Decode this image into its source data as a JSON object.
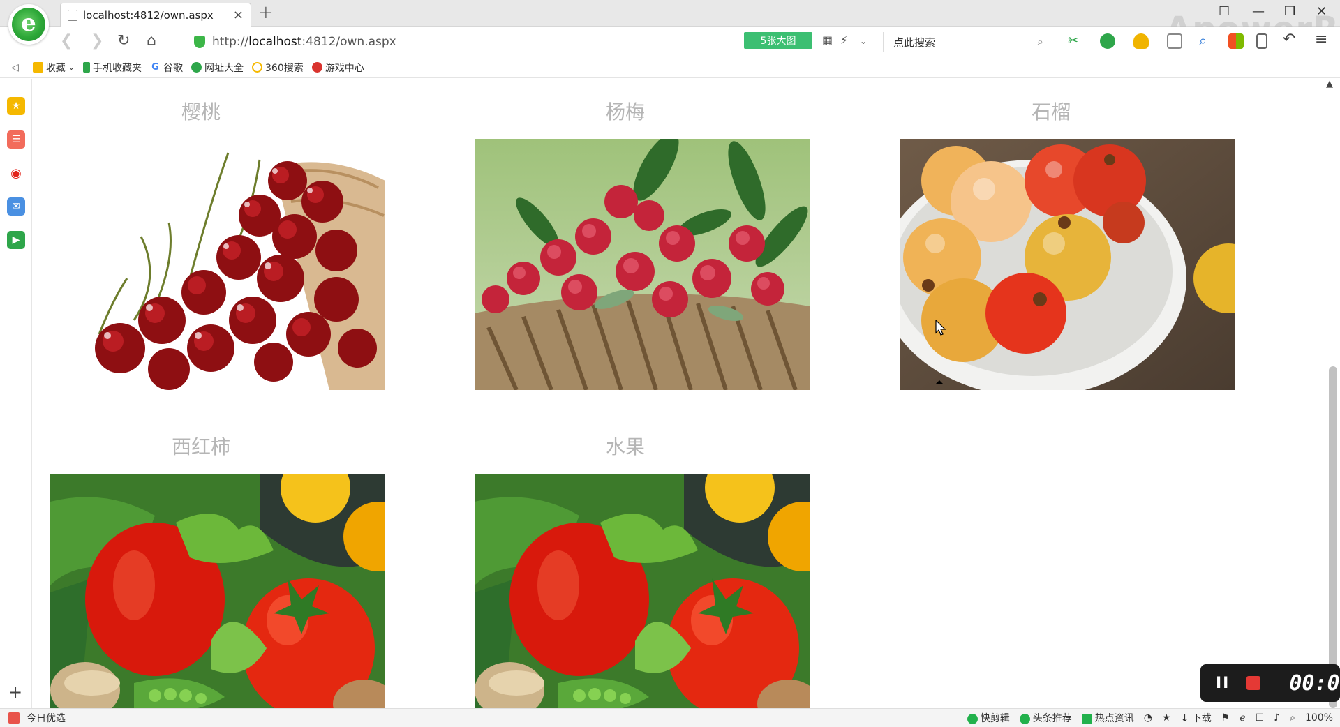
{
  "browser": {
    "tab_title": "localhost:4812/own.aspx",
    "tab_close": "×",
    "new_tab": "+",
    "url_prefix": "http://",
    "url_host": "localhost",
    "url_rest": ":4812/own.aspx",
    "big_image_button": "5张大图",
    "search_placeholder": "点此搜索",
    "watermark": "ApowerREC"
  },
  "bookmarks": [
    {
      "label": "收藏",
      "icon": "star-icon"
    },
    {
      "label": "手机收藏夹",
      "icon": "phone-icon"
    },
    {
      "label": "谷歌",
      "icon": "google-icon"
    },
    {
      "label": "网址大全",
      "icon": "globe-icon"
    },
    {
      "label": "360搜索",
      "icon": "search360-icon"
    },
    {
      "label": "游戏中心",
      "icon": "game-icon"
    }
  ],
  "fruits": [
    {
      "title": "樱桃",
      "image": "cherries"
    },
    {
      "title": "杨梅",
      "image": "bayberries"
    },
    {
      "title": "石榴",
      "image": "pomegranates"
    },
    {
      "title": "西红柿",
      "image": "vegetables"
    },
    {
      "title": "水果",
      "image": "vegetables"
    }
  ],
  "recorder": {
    "pause_label": "II",
    "time": "00:0"
  },
  "status": {
    "left_label": "今日优选",
    "items": [
      "快剪辑",
      "头条推荐",
      "热点资讯",
      "下载"
    ],
    "zoom": "100%"
  },
  "colors": {
    "accent_green": "#3cbf72",
    "title_gray": "#b5b5b5"
  }
}
